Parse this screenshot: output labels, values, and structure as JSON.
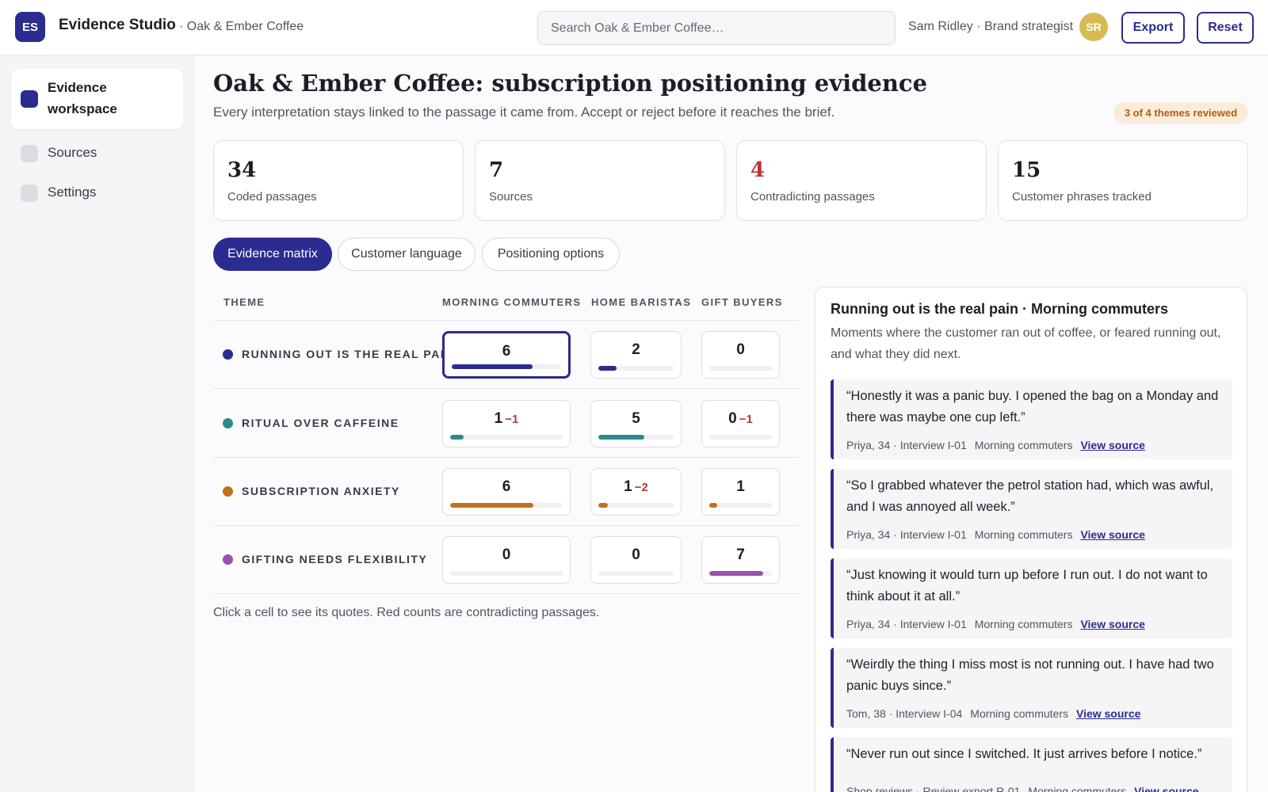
{
  "topbar": {
    "logo": "ES",
    "app_name": "Evidence Studio",
    "project": "· Oak & Ember Coffee",
    "search_placeholder": "Search Oak & Ember Coffee…",
    "user": "Sam Ridley · Brand strategist",
    "avatar": "SR",
    "export_label": "Export",
    "reset_label": "Reset"
  },
  "sidebar": {
    "items": [
      {
        "label": "Evidence workspace",
        "active": true
      },
      {
        "label": "Sources",
        "active": false
      },
      {
        "label": "Settings",
        "active": false
      }
    ]
  },
  "header": {
    "title": "Oak & Ember Coffee: subscription positioning evidence",
    "subtitle": "Every interpretation stays linked to the passage it came from. Accept or reject before it reaches the brief.",
    "review_badge": "3 of 4 themes reviewed"
  },
  "stats": [
    {
      "value": "34",
      "label": "Coded passages"
    },
    {
      "value": "7",
      "label": "Sources"
    },
    {
      "value": "4",
      "label": "Contradicting passages"
    },
    {
      "value": "15",
      "label": "Customer phrases tracked"
    }
  ],
  "tabs": [
    {
      "label": "Evidence matrix",
      "active": true
    },
    {
      "label": "Customer language",
      "active": false
    },
    {
      "label": "Positioning options",
      "active": false
    }
  ],
  "matrix": {
    "headers": [
      "THEME",
      "MORNING COMMUTERS",
      "HOME BARISTAS",
      "GIFT BUYERS"
    ],
    "max_count": 7,
    "rows": [
      {
        "theme": "RUNNING OUT IS THE REAL PAIN",
        "color": "#2b2c8f",
        "cells": [
          {
            "count": "6",
            "contra": "",
            "value": 6,
            "selected": true
          },
          {
            "count": "2",
            "contra": "",
            "value": 2
          },
          {
            "count": "0",
            "contra": "",
            "value": 0
          }
        ]
      },
      {
        "theme": "RITUAL OVER CAFFEINE",
        "color": "#2e8a8a",
        "cells": [
          {
            "count": "1",
            "contra": "−1",
            "value": 1
          },
          {
            "count": "5",
            "contra": "",
            "value": 5
          },
          {
            "count": "0",
            "contra": "−1",
            "value": 0
          }
        ]
      },
      {
        "theme": "SUBSCRIPTION ANXIETY",
        "color": "#c0701f",
        "cells": [
          {
            "count": "6",
            "contra": "",
            "value": 6
          },
          {
            "count": "1",
            "contra": "−2",
            "value": 1
          },
          {
            "count": "1",
            "contra": "",
            "value": 1
          }
        ]
      },
      {
        "theme": "GIFTING NEEDS FLEXIBILITY",
        "color": "#9a4fb0",
        "cells": [
          {
            "count": "0",
            "contra": "",
            "value": 0
          },
          {
            "count": "0",
            "contra": "",
            "value": 0
          },
          {
            "count": "7",
            "contra": "",
            "value": 7
          }
        ]
      }
    ],
    "hint": "Click a cell to see its quotes. Red counts are contradicting passages."
  },
  "panel": {
    "title": "Running out is the real pain · Morning commuters",
    "description": "Moments where the customer ran out of coffee, or feared running out, and what they did next.",
    "quotes": [
      {
        "text": "“Honestly it was a panic buy. I opened the bag on a Monday and there was maybe one cup left.”",
        "source": "Priya, 34 · Interview I-01",
        "segment": "Morning commuters",
        "link": "View source"
      },
      {
        "text": "“So I grabbed whatever the petrol station had, which was awful, and I was annoyed all week.”",
        "source": "Priya, 34 · Interview I-01",
        "segment": "Morning commuters",
        "link": "View source"
      },
      {
        "text": "“Just knowing it would turn up before I run out. I do not want to think about it at all.”",
        "source": "Priya, 34 · Interview I-01",
        "segment": "Morning commuters",
        "link": "View source"
      },
      {
        "text": "“Weirdly the thing I miss most is not running out. I have had two panic buys since.”",
        "source": "Tom, 38 · Interview I-04",
        "segment": "Morning commuters",
        "link": "View source"
      },
      {
        "text": "“Never run out since I switched. It just arrives before I notice.”",
        "source": "Shop reviews · Review export R-01",
        "segment": "Morning commuters",
        "link": "View source"
      }
    ]
  }
}
